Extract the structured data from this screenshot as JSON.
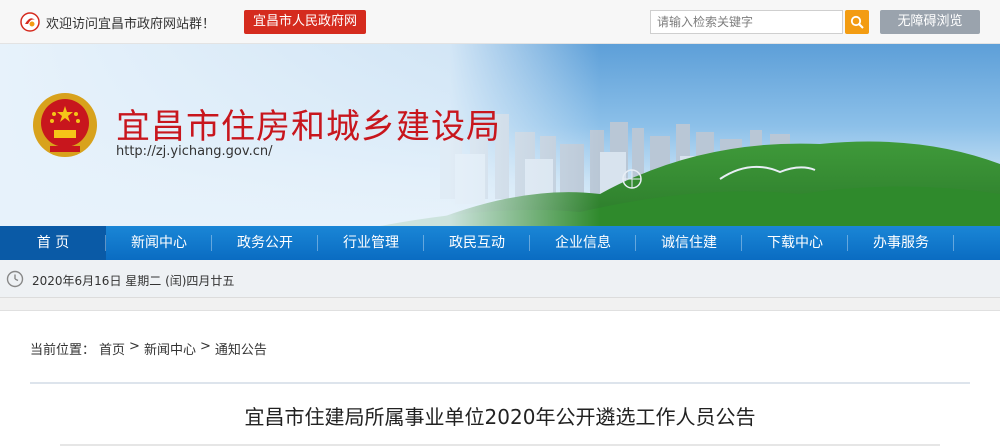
{
  "topbar": {
    "welcome": "欢迎访问宜昌市政府网站群！",
    "gov_link": "宜昌市人民政府网",
    "search_placeholder": "请输入检索关键字",
    "accessibility": "无障碍浏览"
  },
  "header": {
    "title": "宜昌市住房和城乡建设局",
    "url": "http://zj.yichang.gov.cn/",
    "emblem_icon": "national-emblem-icon"
  },
  "nav": {
    "items": [
      {
        "label": "首 页"
      },
      {
        "label": "新闻中心"
      },
      {
        "label": "政务公开"
      },
      {
        "label": "行业管理"
      },
      {
        "label": "政民互动"
      },
      {
        "label": "企业信息"
      },
      {
        "label": "诚信住建"
      },
      {
        "label": "下载中心"
      },
      {
        "label": "办事服务"
      }
    ]
  },
  "datebar": {
    "date": "2020年6月16日 星期二 (闰)四月廿五"
  },
  "breadcrumb": {
    "prefix": "当前位置：",
    "items": [
      "首页",
      ">",
      "新闻中心",
      ">",
      "通知公告"
    ]
  },
  "article": {
    "title": "宜昌市住建局所属事业单位2020年公开遴选工作人员公告"
  },
  "colors": {
    "brand_red": "#c8161d",
    "nav_blue": "#0a6cc2",
    "search_orange": "#f39c12"
  }
}
